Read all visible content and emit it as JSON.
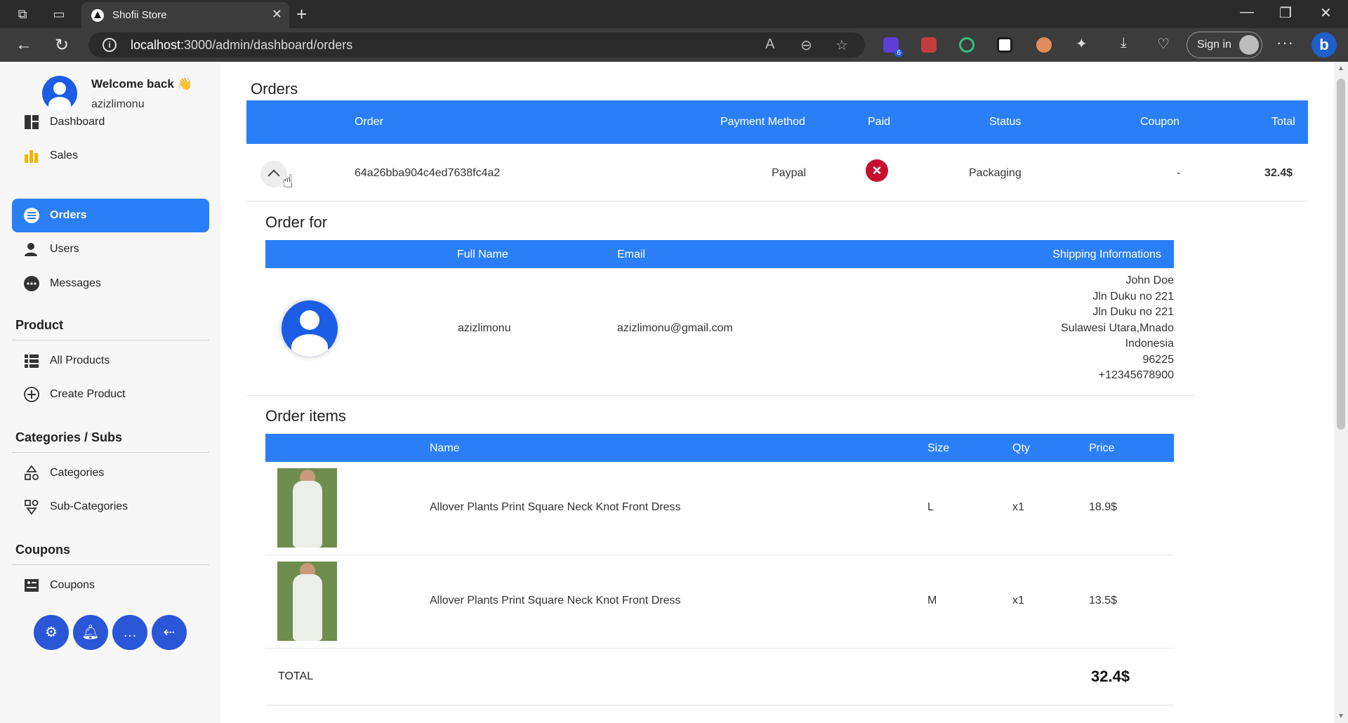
{
  "browser": {
    "tab_title": "Shofii Store",
    "url_host": "localhost",
    "url_rest": ":3000/admin/dashboard/orders",
    "signin_label": "Sign in",
    "ext_badge": "6"
  },
  "sidebar": {
    "welcome": "Welcome back 👋",
    "username": "azizlimonu",
    "nav": [
      {
        "label": "Dashboard",
        "icon": "dashboard-icon"
      },
      {
        "label": "Sales",
        "icon": "bar-chart-icon"
      },
      {
        "label": "Orders",
        "icon": "list-icon",
        "active": true
      },
      {
        "label": "Users",
        "icon": "users-icon"
      },
      {
        "label": "Messages",
        "icon": "messages-icon"
      }
    ],
    "product_title": "Product",
    "product_items": [
      {
        "label": "All Products",
        "icon": "grid-list-icon"
      },
      {
        "label": "Create Product",
        "icon": "plus-circle-icon"
      }
    ],
    "categories_title": "Categories / Subs",
    "categories_items": [
      {
        "label": "Categories",
        "icon": "shapes-icon"
      },
      {
        "label": "Sub-Categories",
        "icon": "sub-categories-icon"
      }
    ],
    "coupons_title": "Coupons",
    "coupons_items": [
      {
        "label": "Coupons",
        "icon": "coupon-icon"
      }
    ]
  },
  "orders": {
    "title": "Orders",
    "headers": {
      "order": "Order",
      "payment": "Payment Method",
      "paid": "Paid",
      "status": "Status",
      "coupon": "Coupon",
      "total": "Total"
    },
    "row": {
      "id": "64a26bba904c4ed7638fc4a2",
      "payment": "Paypal",
      "paid": false,
      "status": "Packaging",
      "coupon": "-",
      "total": "32.4$"
    }
  },
  "order_for": {
    "title": "Order for",
    "headers": {
      "full_name": "Full Name",
      "email": "Email",
      "shipping": "Shipping Informations"
    },
    "full_name": "azizlimonu",
    "email": "azizlimonu@gmail.com",
    "shipping": [
      "John Doe",
      "Jln Duku no 221",
      "Jln Duku no 221",
      "Sulawesi Utara,Mnado",
      "Indonesia",
      "96225",
      "+12345678900"
    ]
  },
  "order_items": {
    "title": "Order items",
    "headers": {
      "name": "Name",
      "size": "Size",
      "qty": "Qty",
      "price": "Price"
    },
    "items": [
      {
        "name": "Allover Plants Print Square Neck Knot Front Dress",
        "size": "L",
        "qty": "x1",
        "price": "18.9$"
      },
      {
        "name": "Allover Plants Print Square Neck Knot Front Dress",
        "size": "M",
        "qty": "x1",
        "price": "13.5$"
      }
    ],
    "total_label": "TOTAL",
    "total_value": "32.4$"
  },
  "colors": {
    "accent": "#2a7ff6",
    "avatar": "#1c5de6",
    "unpaid": "#c8102e",
    "round_buttons": "#2a56d8"
  }
}
